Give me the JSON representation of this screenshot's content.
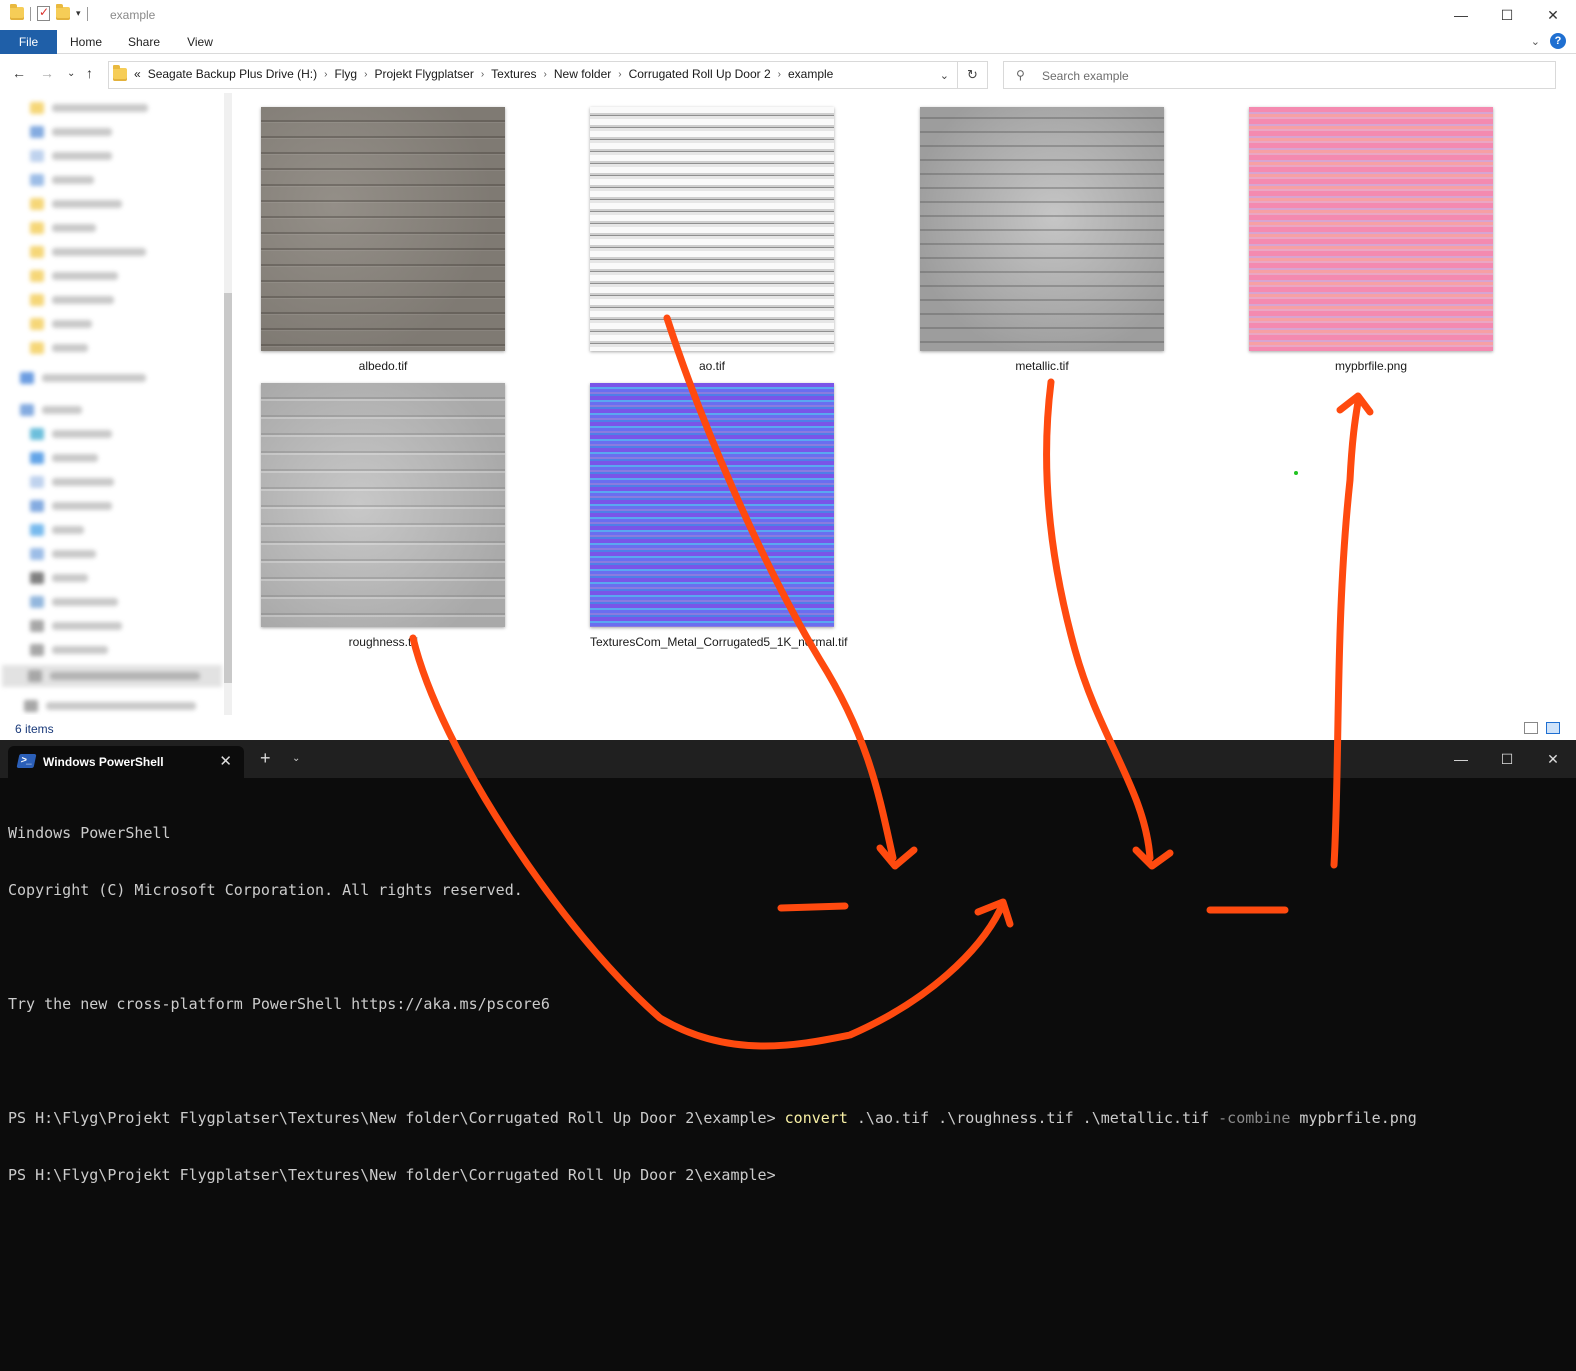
{
  "explorer": {
    "title": "example",
    "ribbon": {
      "file": "File",
      "home": "Home",
      "share": "Share",
      "view": "View"
    },
    "breadcrumbs": [
      "Seagate Backup Plus Drive (H:)",
      "Flyg",
      "Projekt Flygplatser",
      "Textures",
      "New folder",
      "Corrugated Roll Up Door 2",
      "example"
    ],
    "breadcrumb_prefix": "«",
    "search_placeholder": "Search example",
    "files": [
      {
        "name": "albedo.tif",
        "texture": "gray-concrete"
      },
      {
        "name": "ao.tif",
        "texture": "white-stripes"
      },
      {
        "name": "metallic.tif",
        "texture": "gray-metal"
      },
      {
        "name": "mypbrfile.png",
        "texture": "pink-stripes"
      },
      {
        "name": "roughness.tif",
        "texture": "light-gray"
      },
      {
        "name": "TexturesCom_Metal_Corrugated5_1K_normal.tif",
        "texture": "blue-purple-stripes"
      }
    ],
    "status": "6 items"
  },
  "terminal": {
    "tab_title": "Windows PowerShell",
    "lines": [
      "Windows PowerShell",
      "Copyright (C) Microsoft Corporation. All rights reserved.",
      "",
      "Try the new cross-platform PowerShell https://aka.ms/pscore6",
      ""
    ],
    "prompt": "PS H:\\Flyg\\Projekt Flygplatser\\Textures\\New folder\\Corrugated Roll Up Door 2\\example>",
    "command": "convert",
    "arg1": " .\\ao.tif .\\roughness.tif .\\metallic.tif ",
    "flag": "-combine",
    "arg2": " mypbrfile.png",
    "prompt2": "PS H:\\Flyg\\Projekt Flygplatser\\Textures\\New folder\\Corrugated Roll Up Door 2\\example>"
  },
  "colors": {
    "annotation": "#ff4a0f",
    "file_tab": "#1f5fa8",
    "terminal_bg": "#0c0c0c",
    "command": "#f9f1a5"
  },
  "icons": {
    "back": "arrow-left-icon",
    "forward": "arrow-right-icon",
    "up": "arrow-up-icon",
    "refresh": "refresh-icon",
    "search": "search-icon",
    "help": "help-icon",
    "powershell": "powershell-icon"
  }
}
